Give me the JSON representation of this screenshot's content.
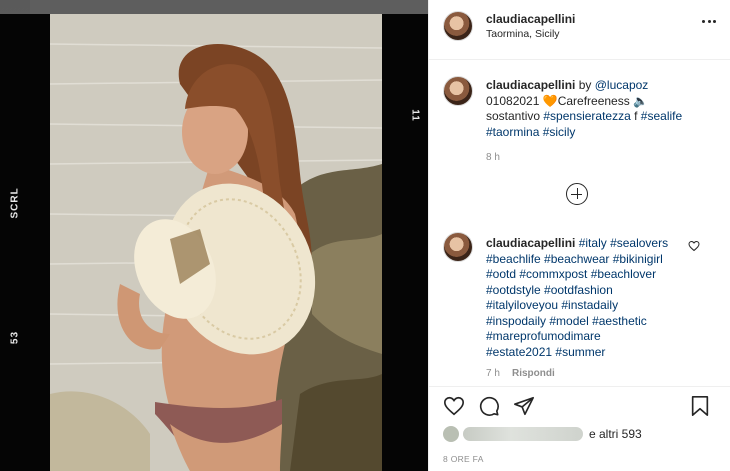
{
  "film_strip": {
    "top_right": "11",
    "left_mid": "SCRL",
    "left_bottom": "53"
  },
  "post": {
    "username": "claudiacapellini",
    "location": "Taormina, Sicily",
    "more_icon": "more-horizontal-icon",
    "caption": {
      "username": "claudiacapellini",
      "by": "by",
      "mention": "@lucapoz",
      "line1_rest": "01082021",
      "emoji_heart": "🧡",
      "word": "Carefreeness",
      "emoji_speaker": "🔈",
      "line2_text": "sostantivo",
      "tag1": "#spensieratezza",
      "line2_f": "f",
      "tag2": "#sealife",
      "tag3": "#taormina",
      "tag4": "#sicily",
      "time": "8 h"
    },
    "load_more_icon": "plus-circle-icon",
    "comment": {
      "username": "claudiacapellini",
      "lines": [
        "#italy #sealovers",
        "#beachlife #beachwear #bikinigirl",
        "#ootd #commxpost #beachlover",
        "#ootdstyle #ootdfashion",
        "#italyiloveyou #instadaily",
        "#inspodaily #model #aesthetic",
        "#mareprofumodimare",
        "#estate2021 #summer"
      ],
      "time": "7 h",
      "reply": "Rispondi",
      "like_icon": "heart-outline-icon"
    },
    "actions": {
      "like_icon": "heart-icon",
      "comment_icon": "comment-icon",
      "share_icon": "share-icon",
      "save_icon": "bookmark-icon"
    },
    "likes_suffix": "e altri 593",
    "date": "8 ORE FA"
  }
}
